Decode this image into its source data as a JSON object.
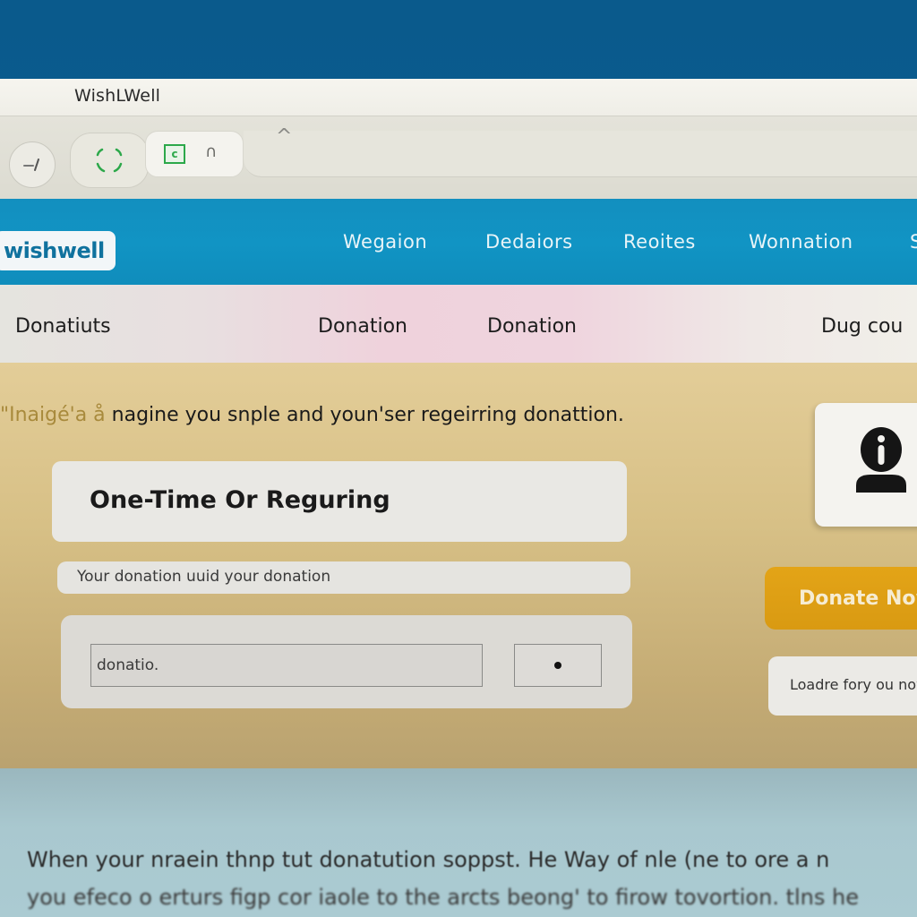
{
  "window": {
    "title": "WishLWell"
  },
  "browser": {
    "back_icon": "back-arrow-icon",
    "reload_icon": "reload-icon",
    "tab_favicon_glyph": "c",
    "tab_lock_glyph": "∩",
    "caret_glyph": "^"
  },
  "site": {
    "logo": "wishwell",
    "nav": [
      {
        "label": "Wegaion"
      },
      {
        "label": "Dedaiors"
      },
      {
        "label": "Reoites"
      },
      {
        "label": "Wonnation"
      },
      {
        "label": "S"
      }
    ],
    "subtabs": [
      {
        "label": "Donatiuts"
      },
      {
        "label": "Donation"
      },
      {
        "label": "Donation"
      },
      {
        "label": "Dug cou"
      }
    ]
  },
  "main": {
    "intro_faded": "\"Inaigé'a å ",
    "intro_text": "nagine you snple and youn'ser regeirring donattion.",
    "card_title": "One-Time Or Reguring",
    "description": "Your donation uuid your donation",
    "amount_input": {
      "value": "donatio."
    },
    "frequency_button_glyph": "•",
    "donate_button": "Donate Now",
    "note": "Loadre fory ou now"
  },
  "footer": {
    "line1": "When your nraein thnp tut donatution soppst. He Way of nle (ne to ore a n",
    "line2": "you efeco o erturs figp cor iaole to the arcts beong' to firow tovortion. tlns he"
  },
  "colors": {
    "nav_bg": "#1194c4",
    "donate_button": "#e3a417",
    "main_bg": "#d7c086",
    "footer_bg": "#a9c8cf",
    "favicon_green": "#2ca84a"
  }
}
